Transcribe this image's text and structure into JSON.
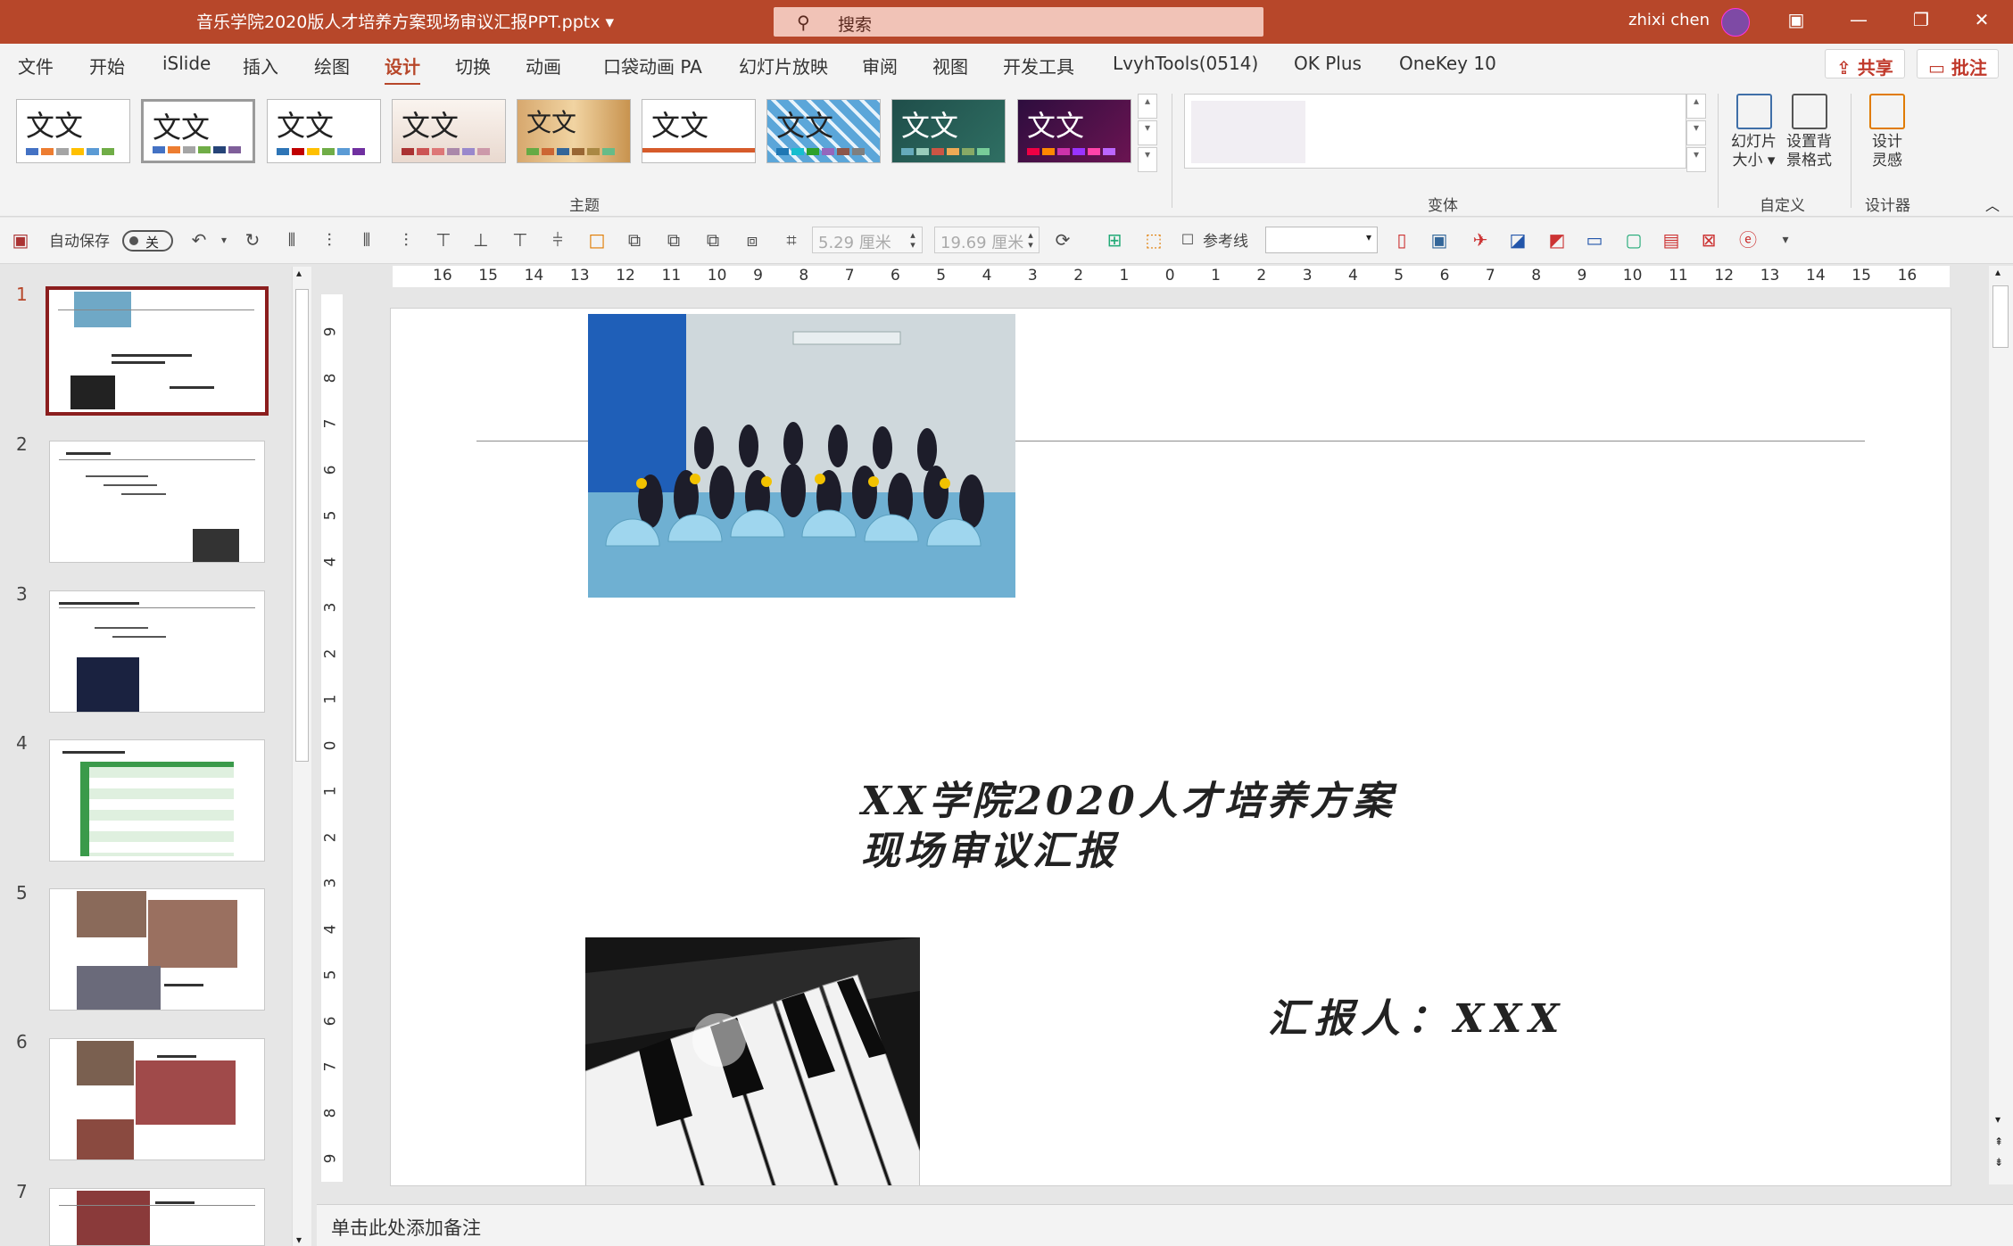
{
  "titlebar": {
    "doc_title": "音乐学院2020版人才培养方案现场审议汇报PPT.pptx",
    "search_placeholder": "搜索",
    "user_name": "zhixi chen",
    "accent": "#b7472a"
  },
  "menu": {
    "tabs": [
      "文件",
      "开始",
      "iSlide",
      "插入",
      "绘图",
      "设计",
      "切换",
      "动画",
      "口袋动画 PA",
      "幻灯片放映",
      "审阅",
      "视图",
      "开发工具",
      "LvyhTools(0514)",
      "OK Plus",
      "OneKey 10"
    ],
    "active": "设计",
    "share": "共享",
    "comment": "批注"
  },
  "ribbon": {
    "theme_sample": "文文",
    "theme_group": "主题",
    "variant_group": "变体",
    "slide_size": [
      "幻灯片",
      "大小"
    ],
    "bg_format": [
      "设置背",
      "景格式"
    ],
    "customize_group": "自定义",
    "design_ideas": [
      "设计",
      "灵感"
    ],
    "designer_group": "设计器"
  },
  "qat": {
    "autosave": "自动保存",
    "autosave_state": "关",
    "width_value": "5.29 厘米",
    "height_value": "19.69 厘米",
    "guides": "参考线"
  },
  "slides": {
    "numbers": [
      "1",
      "2",
      "3",
      "4",
      "5",
      "6",
      "7"
    ],
    "selected": 1
  },
  "ruler": {
    "h_ticks": [
      "16",
      "15",
      "14",
      "13",
      "12",
      "11",
      "10",
      "9",
      "8",
      "7",
      "6",
      "5",
      "4",
      "3",
      "2",
      "1",
      "0",
      "1",
      "2",
      "3",
      "4",
      "5",
      "6",
      "7",
      "8",
      "9",
      "10",
      "11",
      "12",
      "13",
      "14",
      "15",
      "16"
    ],
    "v_ticks": [
      "9",
      "8",
      "7",
      "6",
      "5",
      "4",
      "3",
      "2",
      "1",
      "0",
      "1",
      "2",
      "3",
      "4",
      "5",
      "6",
      "7",
      "8",
      "9"
    ]
  },
  "slide": {
    "title_line1": "XX学院2020人才培养方案",
    "title_line2": "现场审议汇报",
    "reporter": "汇报人：XXX"
  },
  "notes": {
    "placeholder": "单击此处添加备注"
  }
}
